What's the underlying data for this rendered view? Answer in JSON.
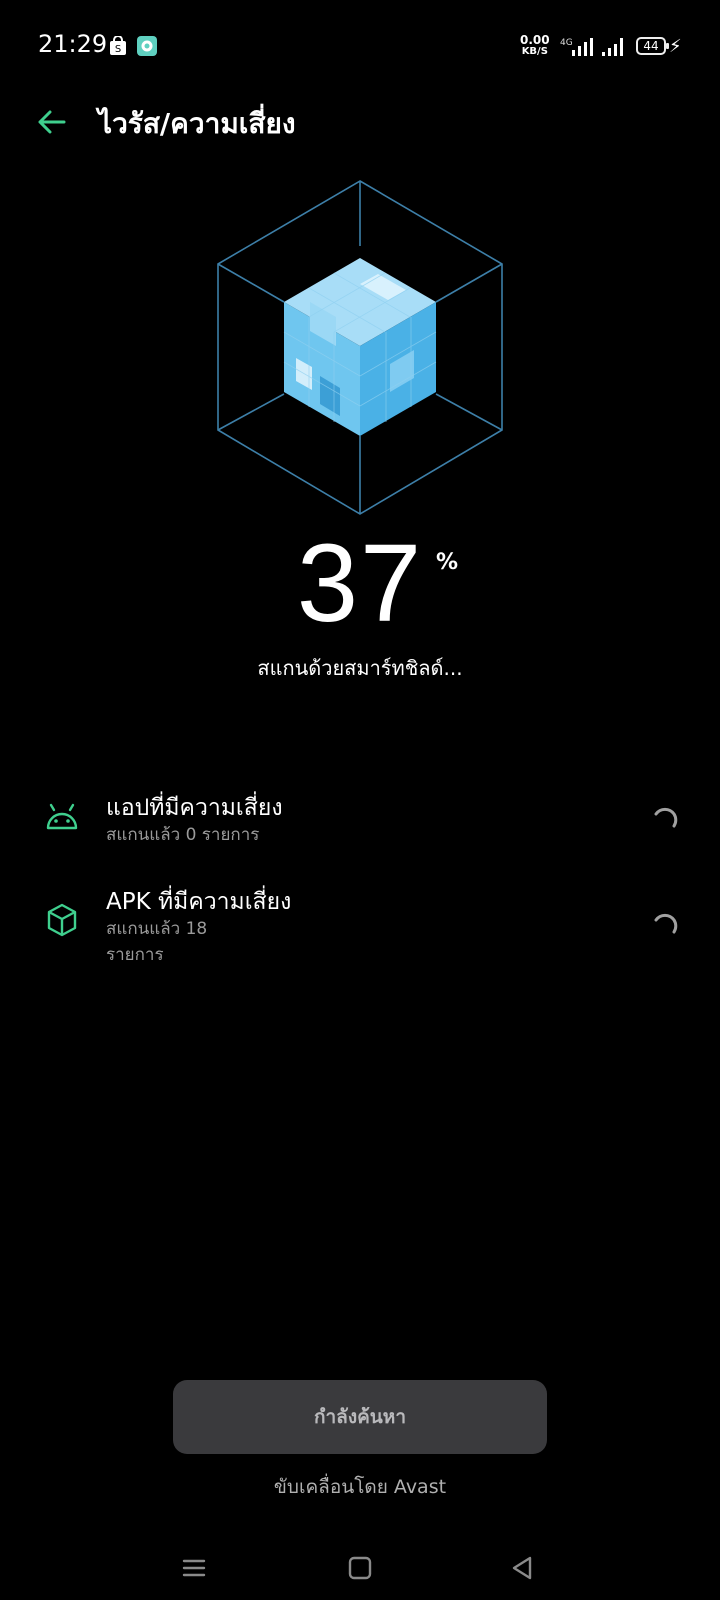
{
  "status_bar": {
    "time": "21:29",
    "net_speed_value": "0.00",
    "net_speed_unit": "KB/S",
    "network": "4G",
    "battery": "44",
    "notification_icons": [
      "shopee-bag-icon",
      "messenger-chat-icon"
    ]
  },
  "header": {
    "title": "ไวรัส/ความเสี่ยง",
    "accent_color": "#3fcf8e"
  },
  "scan": {
    "percent": "37",
    "percent_symbol": "%",
    "status_text": "สแกนด้วยสมาร์ทชิลด์..."
  },
  "items": [
    {
      "icon": "android-icon",
      "title": "แอปที่มีความเสี่ยง",
      "subtitle": "สแกนแล้ว 0 รายการ"
    },
    {
      "icon": "package-cube-icon",
      "title": "APK ที่มีความเสี่ยง",
      "subtitle": "สแกนแล้ว 18 รายการ"
    }
  ],
  "action_button": {
    "label": "กำลังค้นหา"
  },
  "footer": {
    "powered_by": "ขับเคลื่อนโดย Avast"
  }
}
